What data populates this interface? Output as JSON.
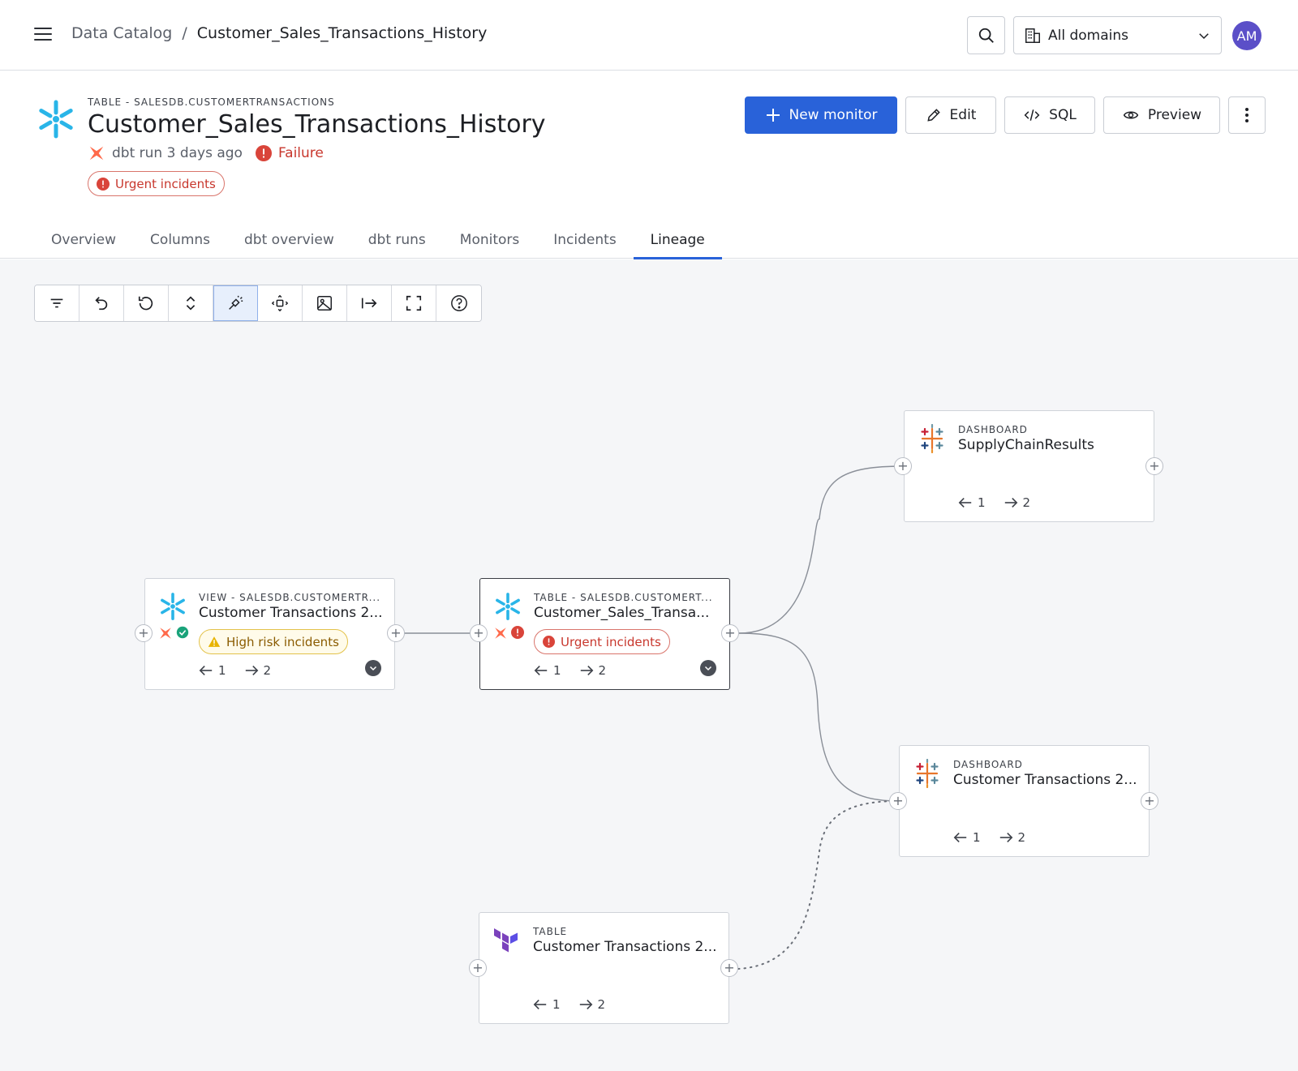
{
  "topbar": {
    "breadcrumb_root": "Data Catalog",
    "breadcrumb_sep": "/",
    "breadcrumb_current": "Customer_Sales_Transactions_History",
    "domains_label": "All domains",
    "avatar_initials": "AM"
  },
  "header": {
    "asset_type": "TABLE - SALESDB.CUSTOMERTRANSACTIONS",
    "asset_title": "Customer_Sales_Transactions_History",
    "dbt_run": "dbt run 3 days ago",
    "status": "Failure",
    "urgent_label": "Urgent incidents"
  },
  "actions": {
    "new_monitor": "New monitor",
    "edit": "Edit",
    "sql": "SQL",
    "preview": "Preview"
  },
  "tabs": [
    {
      "label": "Overview"
    },
    {
      "label": "Columns"
    },
    {
      "label": "dbt overview"
    },
    {
      "label": "dbt runs"
    },
    {
      "label": "Monitors"
    },
    {
      "label": "Incidents"
    },
    {
      "label": "Lineage"
    }
  ],
  "active_tab": "Lineage",
  "toolbar_icons": [
    "filter-icon",
    "undo-icon",
    "reset-icon",
    "expand-collapse-icon",
    "highlight-icon",
    "center-icon",
    "image-export-icon",
    "export-icon",
    "fullscreen-icon",
    "help-icon"
  ],
  "nodes": {
    "view": {
      "type": "VIEW - SALESDB.CUSTOMERTR...",
      "name": "Customer Transactions 2...",
      "pill": "High risk incidents",
      "up": "1",
      "down": "2"
    },
    "table_main": {
      "type": "TABLE - SALESDB.CUSTOMERT...",
      "name": "Customer_Sales_Transa...",
      "pill": "Urgent incidents",
      "up": "1",
      "down": "2"
    },
    "dash_supply": {
      "type": "DASHBOARD",
      "name": "SupplyChainResults",
      "up": "1",
      "down": "2"
    },
    "dash_cust": {
      "type": "DASHBOARD",
      "name": "Customer Transactions 2...",
      "up": "1",
      "down": "2"
    },
    "tf_table": {
      "type": "TABLE",
      "name": "Customer Transactions 2...",
      "up": "1",
      "down": "2"
    }
  },
  "colors": {
    "primary": "#2962d9",
    "failure": "#c8372d",
    "warning": "#e3c24a",
    "snowflake": "#29b5e8",
    "dbt": "#ff694a",
    "terraform": "#7b42bc",
    "avatar": "#5b4fc8"
  }
}
